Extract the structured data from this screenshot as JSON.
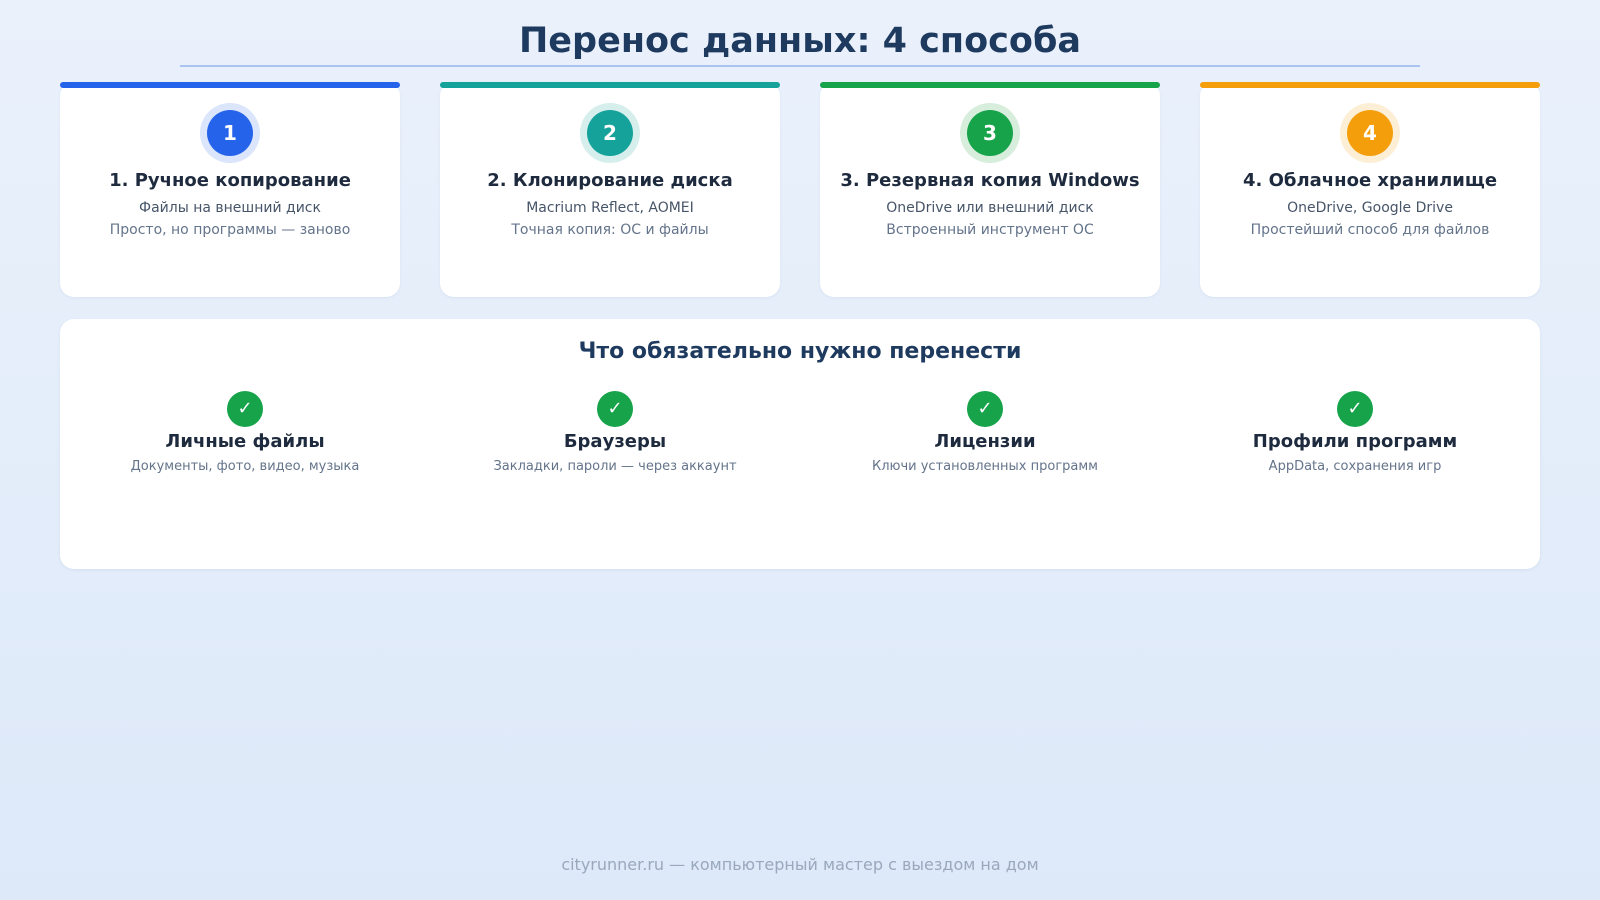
{
  "title": "Перенос данных: 4 способа",
  "methods": [
    {
      "number": "1",
      "title": "1. Ручное копирование",
      "subtitle": "Файлы на внешний диск",
      "note": "Просто, но программы — заново",
      "accent": "#2563eb",
      "halo": "#dbe5fb"
    },
    {
      "number": "2",
      "title": "2. Клонирование диска",
      "subtitle": "Macrium Reflect, AOMEI",
      "note": "Точная копия: ОС и файлы",
      "accent": "#14a29b",
      "halo": "#d6efed"
    },
    {
      "number": "3",
      "title": "3. Резервная копия Windows",
      "subtitle": "OneDrive или внешний диск",
      "note": "Встроенный инструмент ОС",
      "accent": "#16a34a",
      "halo": "#d7eedc"
    },
    {
      "number": "4",
      "title": "4. Облачное хранилище",
      "subtitle": "OneDrive, Google Drive",
      "note": "Простейший способ для файлов",
      "accent": "#f59e0b",
      "halo": "#fcefd6"
    }
  ],
  "checklist": {
    "title": "Что обязательно нужно перенести",
    "check_symbol": "✓",
    "check_color": "#16a34a",
    "items": [
      {
        "title": "Личные файлы",
        "description": "Документы, фото, видео, музыка"
      },
      {
        "title": "Браузеры",
        "description": "Закладки, пароли — через аккаунт"
      },
      {
        "title": "Лицензии",
        "description": "Ключи установленных программ"
      },
      {
        "title": "Профили программ",
        "description": "AppData, сохранения игр"
      }
    ]
  },
  "footer": "cityrunner.ru — компьютерный мастер с выездом на дом"
}
